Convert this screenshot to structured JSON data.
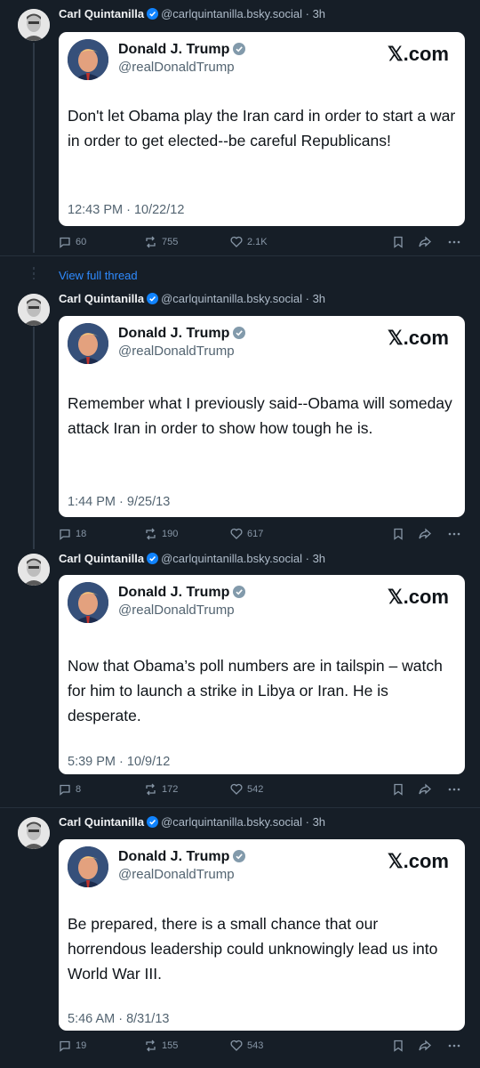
{
  "view_full_thread": "View full thread",
  "posts": [
    {
      "author": {
        "name": "Carl Quintanilla",
        "handle": "@carlquintanilla.bsky.social",
        "age": "· 3h"
      },
      "embed": {
        "name": "Donald J. Trump",
        "handle": "@realDonaldTrump",
        "source": "𝕏.com",
        "text": "Don't let Obama play the Iran card in order to start a war in order to get elected--be careful Republicans!",
        "time": "12:43 PM · 10/22/12"
      },
      "replies": "60",
      "reposts": "755",
      "likes": "2.1K"
    },
    {
      "author": {
        "name": "Carl Quintanilla",
        "handle": "@carlquintanilla.bsky.social",
        "age": "· 3h"
      },
      "embed": {
        "name": "Donald J. Trump",
        "handle": "@realDonaldTrump",
        "source": "𝕏.com",
        "text": "Remember what I previously said--Obama will someday attack Iran in order to show how tough he is.",
        "time": "1:44 PM · 9/25/13"
      },
      "replies": "18",
      "reposts": "190",
      "likes": "617"
    },
    {
      "author": {
        "name": "Carl Quintanilla",
        "handle": "@carlquintanilla.bsky.social",
        "age": "· 3h"
      },
      "embed": {
        "name": "Donald J. Trump",
        "handle": "@realDonaldTrump",
        "source": "𝕏.com",
        "text": "Now that Obama’s poll numbers are in tailspin – watch for him to launch a strike in Libya or Iran.  He is desperate.",
        "time": "5:39 PM · 10/9/12"
      },
      "replies": "8",
      "reposts": "172",
      "likes": "542"
    },
    {
      "author": {
        "name": "Carl Quintanilla",
        "handle": "@carlquintanilla.bsky.social",
        "age": "· 3h"
      },
      "embed": {
        "name": "Donald J. Trump",
        "handle": "@realDonaldTrump",
        "source": "𝕏.com",
        "text": "Be prepared, there is a small chance that our horrendous leadership could unknowingly lead us into World War III.",
        "time": "5:46 AM · 8/31/13"
      },
      "replies": "19",
      "reposts": "155",
      "likes": "543"
    }
  ]
}
